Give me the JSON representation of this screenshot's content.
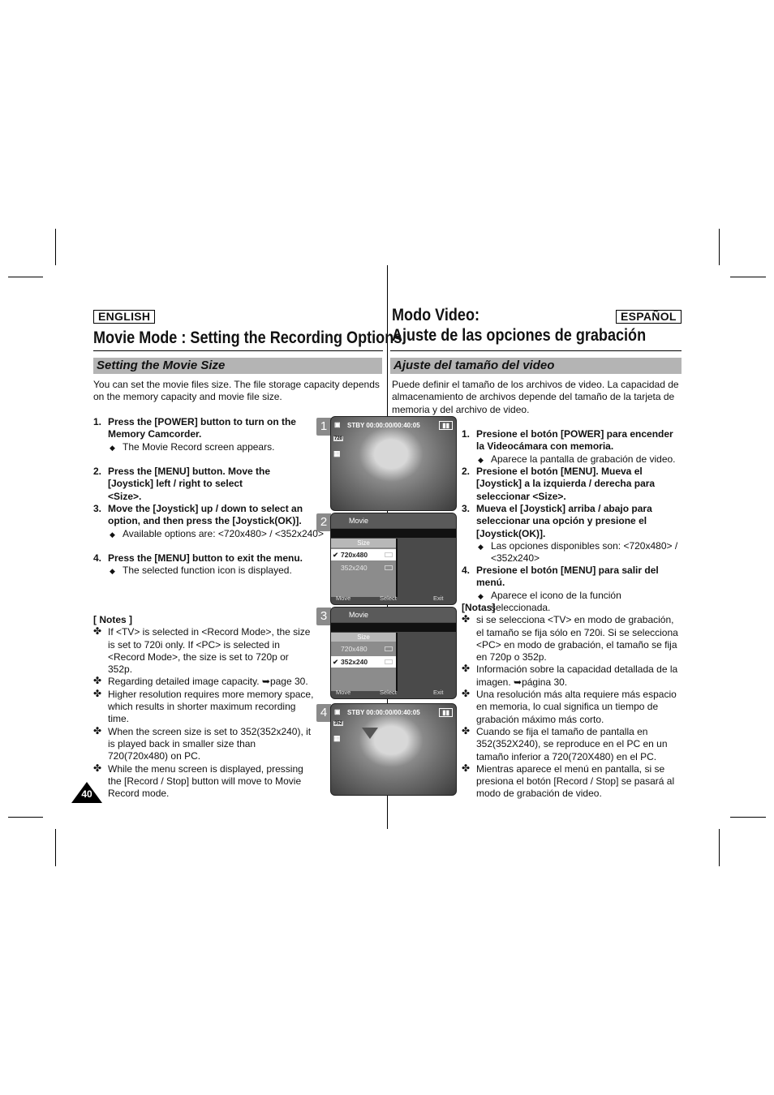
{
  "english": {
    "lang_label": "ENGLISH",
    "title": "Movie Mode : Setting the Recording Options",
    "section": "Setting the Movie Size",
    "intro": "You can set the movie files size. The file storage capacity depends on the memory capacity and movie file size.",
    "steps": [
      {
        "num": "1.",
        "text": "Press the [POWER] button to turn on the Memory Camcorder.",
        "bullet": "The Movie Record screen appears."
      },
      {
        "num": "2.",
        "text": "Press the [MENU] button. Move the [Joystick] left / right to select <Size>."
      },
      {
        "num": "3.",
        "text": "Move the [Joystick] up / down to select an option, and then press the  [Joystick(OK)].",
        "bullet": "Available options are: <720x480> / <352x240>"
      },
      {
        "num": "4.",
        "text": "Press the [MENU] button to exit the menu.",
        "bullet": "The selected function icon is displayed."
      }
    ],
    "notes_title": "[ Notes ]",
    "notes": [
      "If <TV> is selected in <Record Mode>, the size is set to 720i only. If <PC> is selected in <Record Mode>, the size is set to 720p or 352p.",
      "Regarding detailed image capacity. ➥page 30.",
      "Higher resolution requires more memory space, which results in shorter maximum recording time.",
      "When the screen size is set to 352(352x240), it is played back in smaller size than 720(720x480) on PC.",
      "While the menu screen is displayed, pressing the [Record / Stop] button will move to Movie Record mode."
    ]
  },
  "spanish": {
    "lang_label": "ESPAÑOL",
    "title_line1": "Modo Video:",
    "title_line2": "Ajuste de las opciones de grabación",
    "section": "Ajuste del tamaño del video",
    "intro": "Puede definir el tamaño de los archivos de video. La capacidad de almacenamiento de archivos depende del tamaño de la tarjeta de memoria y del archivo de video.",
    "steps": [
      {
        "num": "1.",
        "text": "Presione el botón [POWER] para encender la Videocámara con memoria.",
        "bullet": "Aparece la pantalla de grabación de video."
      },
      {
        "num": "2.",
        "text": "Presione el botón [MENU]. Mueva el [Joystick] a la izquierda / derecha para seleccionar <Size>."
      },
      {
        "num": "3.",
        "text": "Mueva el [Joystick] arriba / abajo para seleccionar una opción y presione el [Joystick(OK)].",
        "bullet": "Las opciones disponibles son: <720x480> / <352x240>"
      },
      {
        "num": "4.",
        "text": "Presione el botón [MENU] para salir del menú.",
        "bullet": "Aparece el icono de la función seleccionada."
      }
    ],
    "notes_title": "[Notas]",
    "notes": [
      "si se selecciona <TV> en modo de grabación, el tamaño se fija sólo en 720i. Si se selecciona <PC> en modo de grabación, el tamaño se fija en 720p o 352p.",
      "Información sobre la capacidad detallada de la imagen. ➥página 30.",
      "Una resolución más alta requiere más espacio en memoria, lo cual significa un tiempo de grabación máximo más corto.",
      "Cuando se fija el tamaño de pantalla en 352(352X240), se reproduce en el PC en un tamaño inferior a 720(720X480) en el PC.",
      "Mientras aparece el menú en pantalla, si se presiona el botón [Record / Stop] se pasará al modo de grabación de video."
    ]
  },
  "screens": {
    "s1": {
      "tab": "1",
      "status": "STBY 00:00:00/00:40:05",
      "size_icon": "720"
    },
    "s2": {
      "tab": "2",
      "menu_title": "Movie",
      "size_header": "Size",
      "options": [
        "720x480",
        "352x240"
      ],
      "selected": 0,
      "move": "Move",
      "select": "Select",
      "exit": "Exit",
      "ok_key": "OK",
      "menu_key": "MENU"
    },
    "s3": {
      "tab": "3",
      "menu_title": "Movie",
      "size_header": "Size",
      "options": [
        "720x480",
        "352x240"
      ],
      "selected": 1,
      "move": "Move",
      "select": "Select",
      "exit": "Exit",
      "ok_key": "OK",
      "menu_key": "MENU"
    },
    "s4": {
      "tab": "4",
      "status": "STBY 00:00:00/00:40:05",
      "size_icon": "352"
    }
  },
  "page_number": "40"
}
